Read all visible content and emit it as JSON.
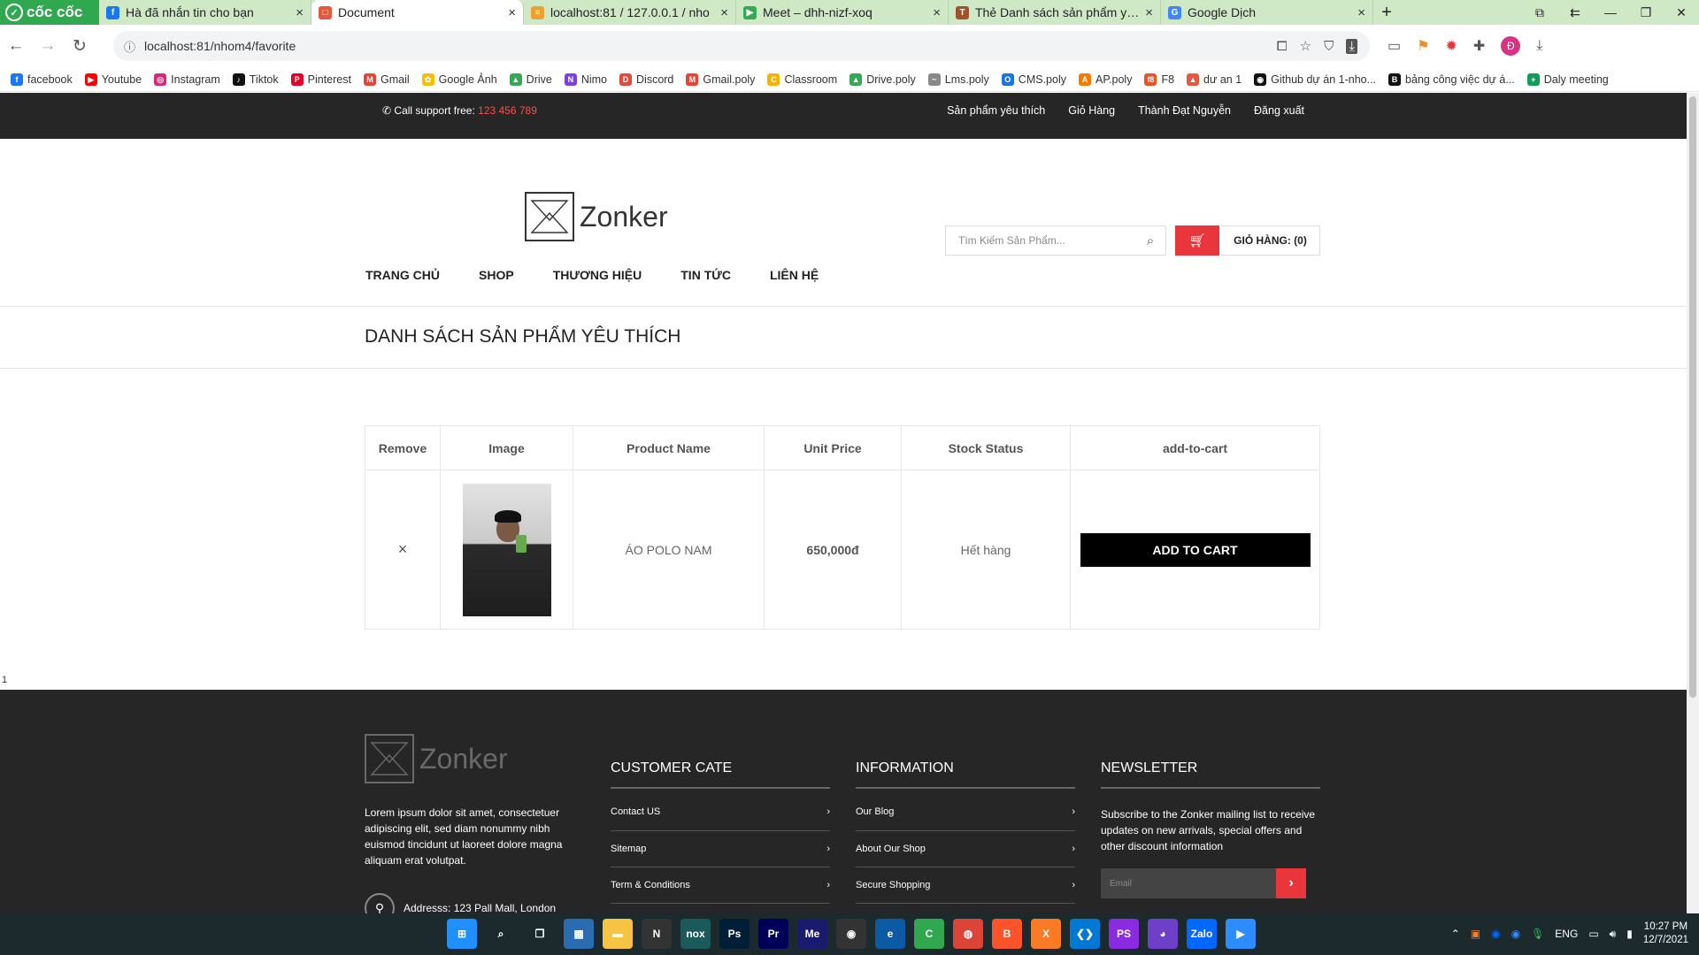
{
  "browser": {
    "brand": "cốc cốc",
    "tabs": [
      {
        "title": "Hà đã nhắn tin cho bạn",
        "color": "#1877f2",
        "glyph": "f"
      },
      {
        "title": "Document",
        "color": "#e8563c",
        "glyph": "□",
        "active": true
      },
      {
        "title": "localhost:81 / 127.0.0.1 / nho",
        "color": "#f0a030",
        "glyph": "≡"
      },
      {
        "title": "Meet – dhh-nizf-xoq",
        "color": "#34a853",
        "glyph": "▶"
      },
      {
        "title": "Thẻ Danh sách sản phẩm yêu",
        "color": "#a0522d",
        "glyph": "T"
      },
      {
        "title": "Google Dịch",
        "color": "#4285f4",
        "glyph": "G"
      }
    ],
    "url": "localhost:81/nhom4/favorite",
    "profile_initial": "Đ",
    "bookmarks": [
      {
        "label": "facebook",
        "color": "#1877f2",
        "glyph": "f"
      },
      {
        "label": "Youtube",
        "color": "#ff0000",
        "glyph": "▶"
      },
      {
        "label": "Instagram",
        "color": "#d62976",
        "glyph": "◎"
      },
      {
        "label": "Tiktok",
        "color": "#111111",
        "glyph": "♪"
      },
      {
        "label": "Pinterest",
        "color": "#e60023",
        "glyph": "P"
      },
      {
        "label": "Gmail",
        "color": "#ea4335",
        "glyph": "M"
      },
      {
        "label": "Google Ảnh",
        "color": "#fbbc05",
        "glyph": "✿"
      },
      {
        "label": "Drive",
        "color": "#34a853",
        "glyph": "▲"
      },
      {
        "label": "Nimo",
        "color": "#7b3fe4",
        "glyph": "N"
      },
      {
        "label": "Discord",
        "color": "#e24a3b",
        "glyph": "D"
      },
      {
        "label": "Gmail.poly",
        "color": "#ea4335",
        "glyph": "M"
      },
      {
        "label": "Classroom",
        "color": "#f4b400",
        "glyph": "C"
      },
      {
        "label": "Drive.poly",
        "color": "#34a853",
        "glyph": "▲"
      },
      {
        "label": "Lms.poly",
        "color": "#888888",
        "glyph": "~"
      },
      {
        "label": "CMS.poly",
        "color": "#1a73e8",
        "glyph": "O"
      },
      {
        "label": "AP.poly",
        "color": "#f57c00",
        "glyph": "A"
      },
      {
        "label": "F8",
        "color": "#f05123",
        "glyph": "f8"
      },
      {
        "label": "dư an 1",
        "color": "#e8563c",
        "glyph": "▲"
      },
      {
        "label": "Github dự án 1-nho...",
        "color": "#111111",
        "glyph": "◉"
      },
      {
        "label": "bảng công việc dự á...",
        "color": "#111111",
        "glyph": "B"
      },
      {
        "label": "Daly meeting",
        "color": "#0f9d58",
        "glyph": "+"
      }
    ]
  },
  "site": {
    "support_label": "Call support free:",
    "support_phone": "123 456 789",
    "top_links": [
      "Sản phẩm yêu thích",
      "Giỏ Hàng",
      "Thành Đạt Nguyễn",
      "Đăng xuất"
    ],
    "logo_text": "Zonker",
    "search_placeholder": "Tìm Kiếm Sản Phẩm...",
    "cart_label": "GIỎ HÀNG: (0)",
    "nav": [
      "TRANG CHỦ",
      "SHOP",
      "THƯƠNG HIỆU",
      "TIN TỨC",
      "LIÊN HỆ"
    ],
    "page_title": "DANH SÁCH SẢN PHẨM YÊU THÍCH",
    "accent_color": "#e8363c"
  },
  "favorites_table": {
    "headers": [
      "Remove",
      "Image",
      "Product Name",
      "Unit Price",
      "Stock Status",
      "add-to-cart"
    ],
    "rows": [
      {
        "remove": "×",
        "name": "ÁO POLO NAM",
        "price": "650,000đ",
        "stock": "Hết hàng",
        "action": "ADD TO CART"
      }
    ]
  },
  "stray_text": "1",
  "footer": {
    "logo_text": "Zonker",
    "about": "Lorem ipsum dolor sit amet, consectetuer adipiscing elit, sed diam nonummy nibh euismod tincidunt ut laoreet dolore magna aliquam erat volutpat.",
    "address": "Addresss: 123 Pall Mall, London",
    "col1": {
      "title": "CUSTOMER CATE",
      "items": [
        "Contact US",
        "Sitemap",
        "Term & Conditions"
      ]
    },
    "col2": {
      "title": "INFORMATION",
      "items": [
        "Our Blog",
        "About Our Shop",
        "Secure Shopping"
      ]
    },
    "newsletter": {
      "title": "NEWSLETTER",
      "text": "Subscribe to the Zonker mailing list to receive updates on new arrivals, special offers and other discount information",
      "placeholder": "Email"
    }
  },
  "taskbar": {
    "apps": [
      {
        "name": "windows-start",
        "color": "#1e90ff",
        "glyph": "⊞"
      },
      {
        "name": "search",
        "color": "transparent",
        "glyph": "⌕"
      },
      {
        "name": "task-view",
        "color": "transparent",
        "glyph": "❐"
      },
      {
        "name": "store",
        "color": "#2b6cb0",
        "glyph": "▦"
      },
      {
        "name": "file-explorer",
        "color": "#f6c343",
        "glyph": "▬"
      },
      {
        "name": "notion",
        "color": "#333333",
        "glyph": "N"
      },
      {
        "name": "nox",
        "color": "#1a5a5a",
        "glyph": "nox"
      },
      {
        "name": "photoshop",
        "color": "#001e36",
        "glyph": "Ps"
      },
      {
        "name": "premiere",
        "color": "#00005b",
        "glyph": "Pr"
      },
      {
        "name": "media-encoder",
        "color": "#1a1a6e",
        "glyph": "Me"
      },
      {
        "name": "obs",
        "color": "#333333",
        "glyph": "◉"
      },
      {
        "name": "edge",
        "color": "#0c59a4",
        "glyph": "e"
      },
      {
        "name": "coccoc",
        "color": "#2fa84f",
        "glyph": "C"
      },
      {
        "name": "chrome",
        "color": "#db4437",
        "glyph": "◍"
      },
      {
        "name": "brave",
        "color": "#fb542b",
        "glyph": "B"
      },
      {
        "name": "xampp",
        "color": "#fb7a24",
        "glyph": "X"
      },
      {
        "name": "vscode",
        "color": "#0078d4",
        "glyph": "❮❯"
      },
      {
        "name": "phpstorm",
        "color": "#8a2be2",
        "glyph": "PS"
      },
      {
        "name": "github-desktop",
        "color": "#6e40c9",
        "glyph": "◕"
      },
      {
        "name": "zalo",
        "color": "#0068ff",
        "glyph": "Zalo"
      },
      {
        "name": "zoom",
        "color": "#2d8cff",
        "glyph": "▶"
      }
    ],
    "language": "ENG",
    "time": "10:27 PM",
    "date": "12/7/2021"
  }
}
